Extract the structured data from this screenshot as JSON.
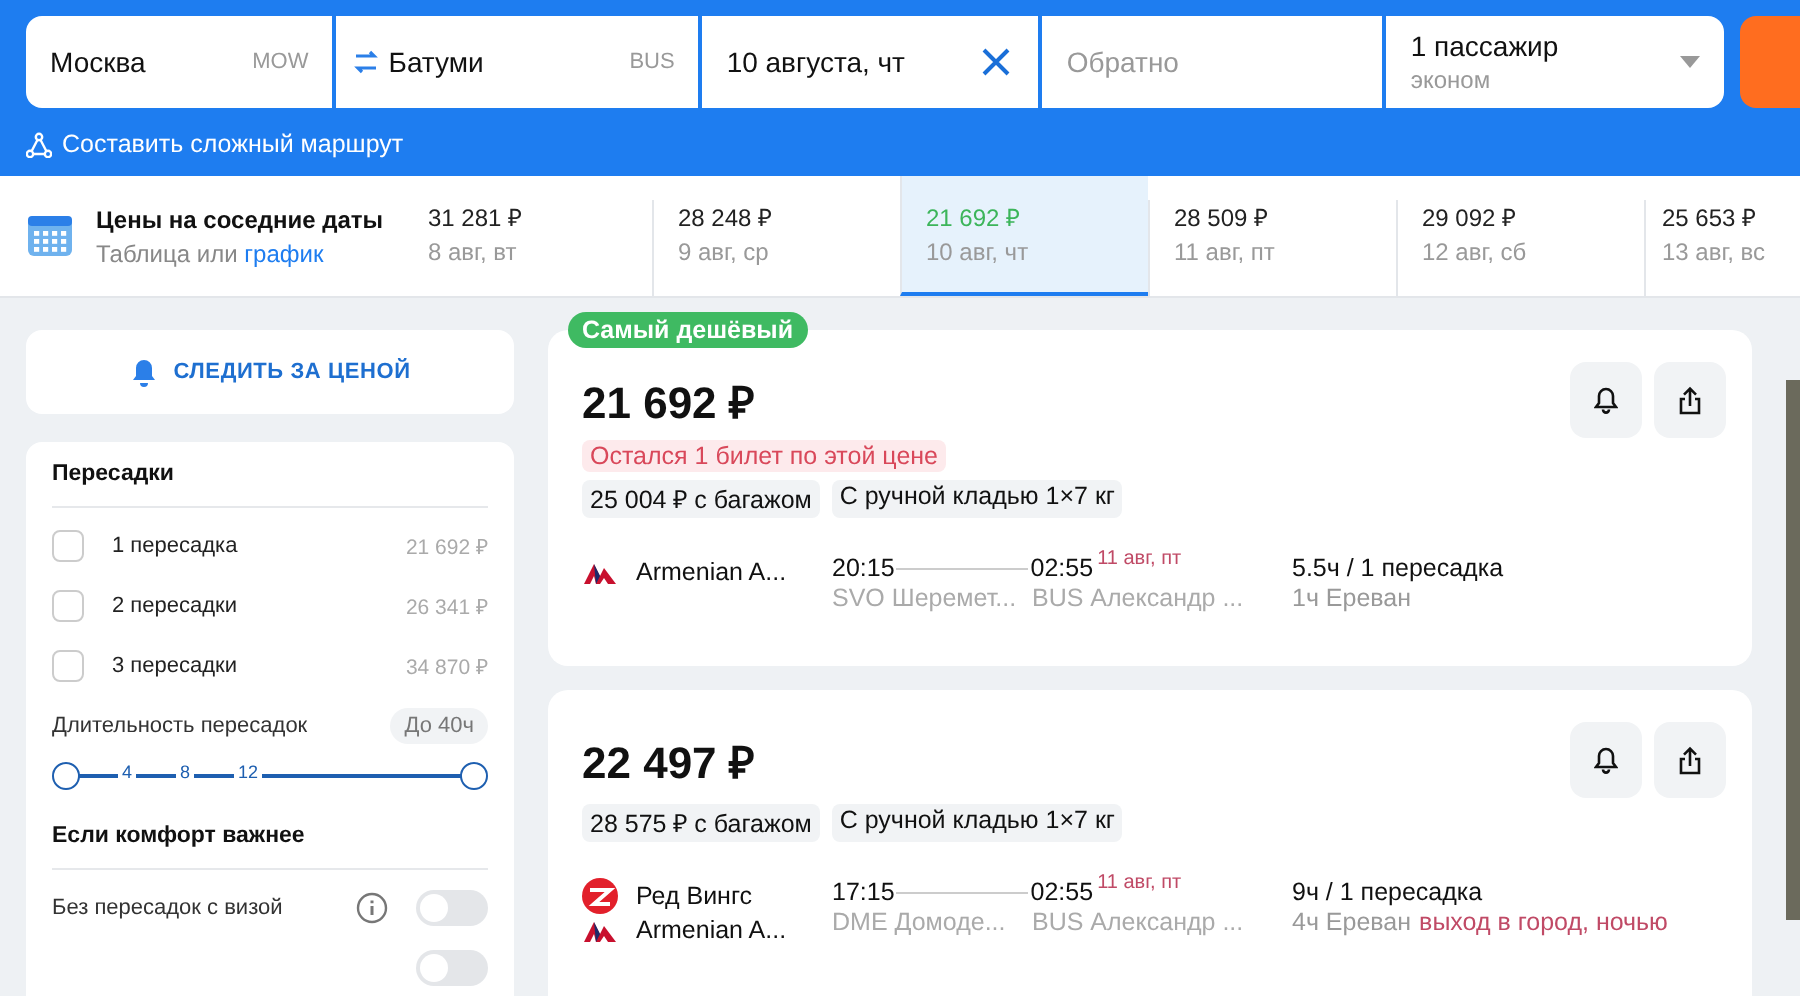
{
  "search": {
    "origin": {
      "city": "Москва",
      "code": "MOW"
    },
    "destination": {
      "city": "Батуми",
      "code": "BUS"
    },
    "depart": "10 августа, чт",
    "return_placeholder": "Обратно",
    "passengers": "1 пассажир",
    "cabin": "эконом",
    "complex_route": "Составить сложный маршрут"
  },
  "dates": {
    "title": "Цены на соседние даты",
    "subtitle": "Таблица или",
    "link": "график",
    "items": [
      {
        "price": "31 281 ₽",
        "date": "8 авг, вт",
        "selected": false
      },
      {
        "price": "28 248 ₽",
        "date": "9 авг, ср",
        "selected": false
      },
      {
        "price": "21 692 ₽",
        "date": "10 авг, чт",
        "selected": true
      },
      {
        "price": "28 509 ₽",
        "date": "11 авг, пт",
        "selected": false
      },
      {
        "price": "29 092 ₽",
        "date": "12 авг, сб",
        "selected": false
      },
      {
        "price": "25 653 ₽",
        "date": "13 авг, вс",
        "selected": false
      }
    ]
  },
  "sidebar": {
    "track_button": "СЛЕДИТЬ ЗА ЦЕНОЙ",
    "transfers": {
      "title": "Пересадки",
      "options": [
        {
          "label": "1 пересадка",
          "price": "21 692 ₽",
          "checked": false
        },
        {
          "label": "2 пересадки",
          "price": "26 341 ₽",
          "checked": false
        },
        {
          "label": "3 пересадки",
          "price": "34 870 ₽",
          "checked": false
        }
      ]
    },
    "duration": {
      "title": "Длительность пересадок",
      "value": "До 40ч",
      "ticks": [
        "4",
        "8",
        "12"
      ],
      "thumbs": [
        {
          "level": 0
        },
        {
          "level": 1
        }
      ]
    },
    "comfort": {
      "title": "Если комфорт важнее",
      "toggles": [
        {
          "label": "Без пересадок с визой",
          "on": false
        },
        {
          "on": false
        }
      ]
    }
  },
  "results": [
    {
      "badge": "Самый дешёвый",
      "price": "21 692 ₽",
      "warning": "Остался 1 билет по этой цене",
      "tags": [
        "25 004 ₽ с багажом",
        "С ручной кладью 1×7 кг"
      ],
      "airlines": [
        {
          "kind": "armenian",
          "name": "Armenian A..."
        }
      ],
      "dep_time": "20:15",
      "dep_airport": "SVO Шеремет...",
      "arr_time": "02:55",
      "arr_date": "11 авг, пт",
      "arr_airport": "BUS Александр ...",
      "duration": "5.5ч / 1 пересадка",
      "layover": "1ч Ереван"
    },
    {
      "price": "22 497 ₽",
      "tags": [
        "28 575 ₽ с багажом",
        "С ручной кладью 1×7 кг"
      ],
      "airlines": [
        {
          "kind": "redwings",
          "name": "Ред Вингс"
        },
        {
          "kind": "armenian",
          "name": "Armenian A..."
        }
      ],
      "dep_time": "17:15",
      "dep_airport": "DME Домоде...",
      "arr_time": "02:55",
      "arr_date": "11 авг, пт",
      "arr_airport": "BUS Александр ...",
      "duration": "9ч / 1 пересадка",
      "layover": "4ч Ереван",
      "layover_note": "выход в город, ночью"
    }
  ]
}
